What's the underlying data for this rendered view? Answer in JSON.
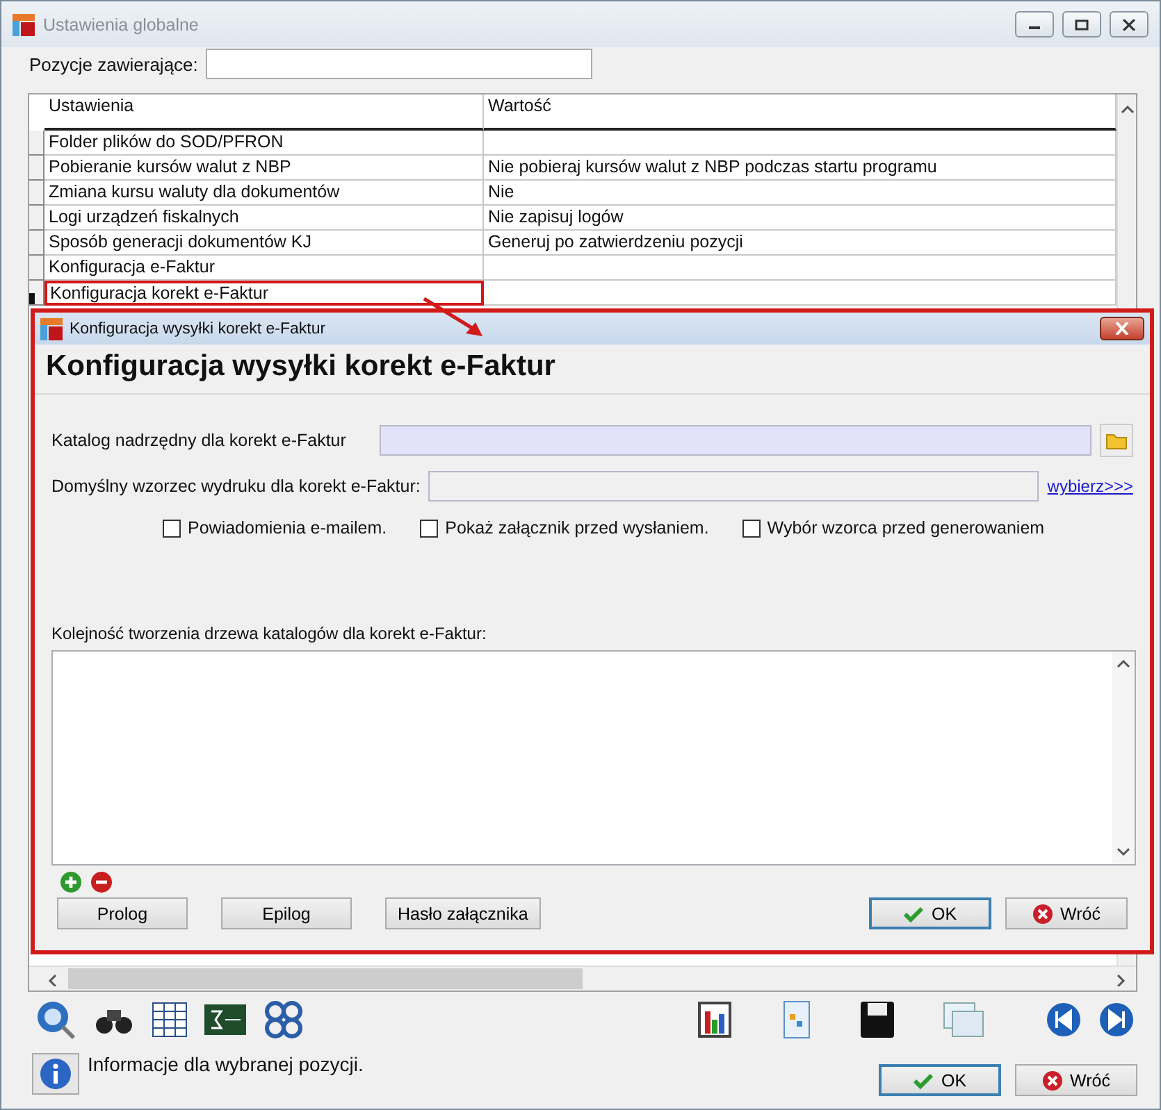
{
  "window": {
    "title": "Ustawienia globalne"
  },
  "filter": {
    "label": "Pozycje zawierające:"
  },
  "table": {
    "columns": [
      "Ustawienia",
      "Wartość"
    ],
    "rows": [
      {
        "setting": "Folder plików do SOD/PFRON",
        "value": "",
        "selected": false,
        "highlighted": false
      },
      {
        "setting": "Pobieranie kursów walut z NBP",
        "value": "Nie pobieraj kursów walut z NBP podczas startu programu",
        "selected": false,
        "highlighted": false
      },
      {
        "setting": "Zmiana kursu waluty dla dokumentów",
        "value": "Nie",
        "selected": false,
        "highlighted": false
      },
      {
        "setting": "Logi urządzeń fiskalnych",
        "value": "Nie zapisuj logów",
        "selected": false,
        "highlighted": false
      },
      {
        "setting": "Sposób generacji dokumentów KJ",
        "value": "Generuj po zatwierdzeniu pozycji",
        "selected": false,
        "highlighted": false
      },
      {
        "setting": "Konfiguracja e-Faktur",
        "value": "",
        "selected": false,
        "highlighted": false
      },
      {
        "setting": "Konfiguracja korekt e-Faktur",
        "value": "",
        "selected": true,
        "highlighted": true
      }
    ]
  },
  "dialog": {
    "title": "Konfiguracja wysyłki korekt e-Faktur",
    "heading": "Konfiguracja wysyłki korekt e-Faktur",
    "fields": [
      {
        "label": "Katalog nadrzędny dla korekt e-Faktur",
        "kind": "folder"
      },
      {
        "label": "Domyślny wzorzec wydruku dla korekt e-Faktur:",
        "kind": "link",
        "link": "wybierz>>>"
      }
    ],
    "checkboxes": [
      {
        "label": "Powiadomienia e-mailem.",
        "checked": false
      },
      {
        "label": "Pokaż załącznik przed wysłaniem.",
        "checked": false
      },
      {
        "label": "Wybór wzorca przed generowaniem",
        "checked": false
      }
    ],
    "list_label": "Kolejność tworzenia drzewa katalogów dla korekt e-Faktur:",
    "left_buttons": [
      "Prolog",
      "Epilog",
      "Hasło załącznika"
    ],
    "ok": "OK",
    "cancel": "Wróć"
  },
  "info": "Informacje dla wybranej pozycji.",
  "ok": "OK",
  "cancel": "Wróć"
}
